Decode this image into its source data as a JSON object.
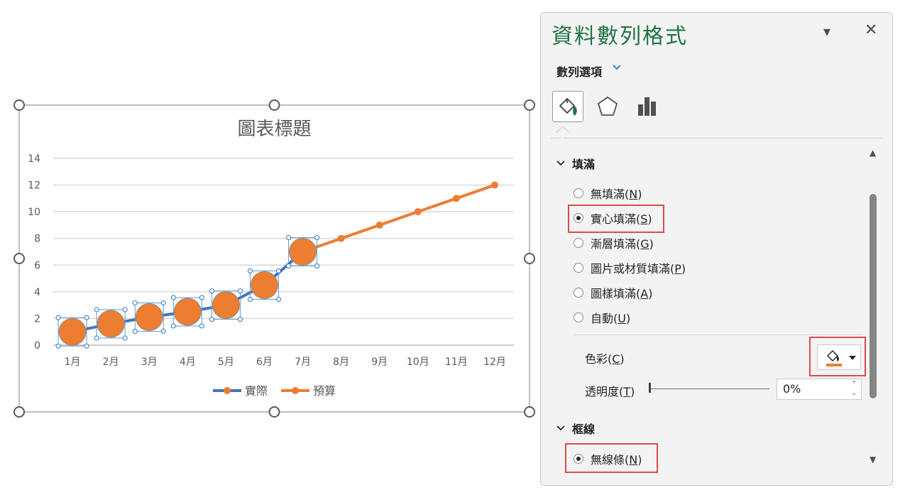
{
  "chart_data": {
    "type": "line",
    "title": "圖表標題",
    "categories": [
      "1月",
      "2月",
      "3月",
      "4月",
      "5月",
      "6月",
      "7月",
      "8月",
      "9月",
      "10月",
      "11月",
      "12月"
    ],
    "ylim": [
      0,
      14
    ],
    "yticks": [
      0,
      2,
      4,
      6,
      8,
      10,
      12,
      14
    ],
    "grid": true,
    "legend_position": "bottom",
    "series": [
      {
        "name": "實際",
        "color": "#4472c4",
        "values": [
          1,
          1.6,
          2.1,
          2.5,
          3,
          4.5,
          7
        ]
      },
      {
        "name": "預算",
        "color": "#ed7d31",
        "values": [
          null,
          null,
          null,
          null,
          null,
          null,
          7,
          8,
          9,
          10,
          11,
          12
        ]
      }
    ],
    "marker_fill_color": "#ed7d31"
  },
  "pane": {
    "title": "資料數列格式",
    "menu_icon": "chevron-down-icon",
    "close_icon": "close-icon",
    "subtitle": "數列選項",
    "tabs": [
      {
        "icon": "fill-line-icon",
        "active": true
      },
      {
        "icon": "effects-pentagon-icon",
        "active": false
      },
      {
        "icon": "series-options-bar-icon",
        "active": false
      }
    ],
    "fill_section": {
      "label": "填滿",
      "options": [
        {
          "text": "無填滿(",
          "key": "N",
          "selected": false
        },
        {
          "text": "實心填滿(",
          "key": "S",
          "selected": true
        },
        {
          "text": "漸層填滿(",
          "key": "G",
          "selected": false
        },
        {
          "text": "圖片或材質填滿(",
          "key": "P",
          "selected": false
        },
        {
          "text": "圖樣填滿(",
          "key": "A",
          "selected": false
        },
        {
          "text": "自動(",
          "key": "U",
          "selected": false
        }
      ],
      "color_label": "色彩(",
      "color_key": "C",
      "color_value": "#ed7d31",
      "transparency_label": "透明度(",
      "transparency_key": "T",
      "transparency_value": "0%"
    },
    "border_section": {
      "label": "框線",
      "options": [
        {
          "text": "無線條(",
          "key": "N",
          "selected": true
        }
      ]
    },
    "highlight_color": "#e04a4a"
  }
}
